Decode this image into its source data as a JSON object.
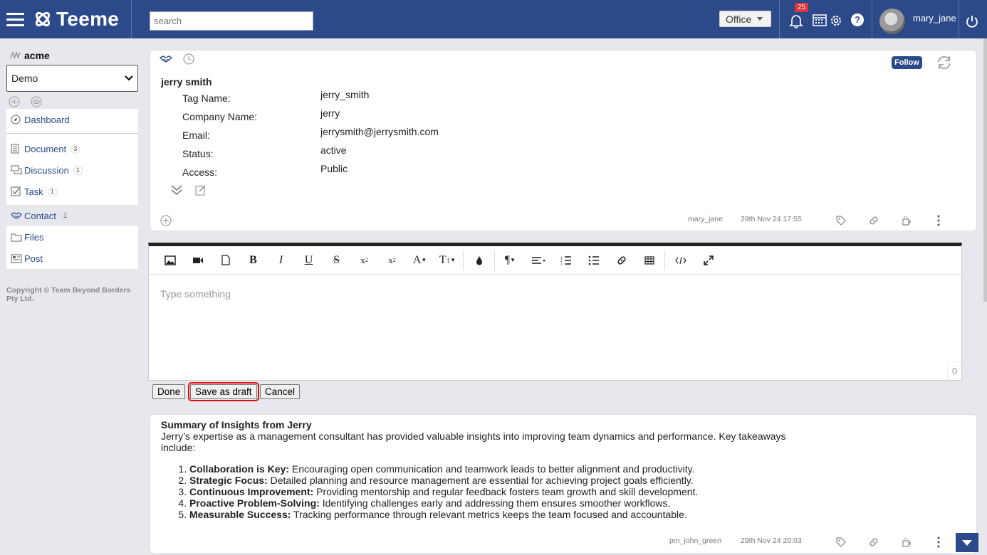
{
  "header": {
    "brand": "Teeme",
    "search_placeholder": "search",
    "office_label": "Office",
    "notification_count": "25",
    "help_label": "?",
    "username": "mary_jane"
  },
  "sidebar": {
    "org_name": "acme",
    "workspace": "Demo",
    "items": [
      {
        "label": "Dashboard",
        "count": ""
      },
      {
        "label": "Document",
        "count": "3"
      },
      {
        "label": "Discussion",
        "count": "1"
      },
      {
        "label": "Task",
        "count": "1"
      },
      {
        "label": "Contact",
        "count": "1"
      },
      {
        "label": "Files",
        "count": ""
      },
      {
        "label": "Post",
        "count": ""
      }
    ],
    "copyright": "Copyright © Team Beyond Borders Pty Ltd."
  },
  "contact": {
    "name": "jerry smith",
    "follow_label": "Follow",
    "fields": [
      {
        "label": "Tag Name:",
        "value": "jerry_smith"
      },
      {
        "label": "Company Name:",
        "value": "jerry"
      },
      {
        "label": "Email:",
        "value": "jerrysmith@jerrysmith.com"
      },
      {
        "label": "Status:",
        "value": "active"
      },
      {
        "label": "Access:",
        "value": "Public"
      }
    ],
    "author": "mary_jane",
    "timestamp": "29th Nov 24 17:55"
  },
  "editor": {
    "placeholder": "Type something",
    "char_count": "0",
    "buttons": {
      "done": "Done",
      "save_draft": "Save as draft",
      "cancel": "Cancel"
    }
  },
  "post": {
    "title": "Summary of Insights from Jerry",
    "intro": "Jerry’s expertise as a management consultant has provided valuable insights into improving team dynamics and performance. Key takeaways include:",
    "points": [
      {
        "bold": "Collaboration is Key:",
        "text": " Encouraging open communication and teamwork leads to better alignment and productivity."
      },
      {
        "bold": "Strategic Focus:",
        "text": " Detailed planning and resource management are essential for achieving project goals efficiently."
      },
      {
        "bold": "Continuous Improvement:",
        "text": " Providing mentorship and regular feedback fosters team growth and skill development."
      },
      {
        "bold": "Proactive Problem-Solving:",
        "text": " Identifying challenges early and addressing them ensures smoother workflows."
      },
      {
        "bold": "Measurable Success:",
        "text": " Tracking performance through relevant metrics keeps the team focused and accountable."
      }
    ],
    "author": "pm_john_green",
    "timestamp": "29th Nov 24 20:03"
  },
  "colors": {
    "brand": "#2c4a8a",
    "badge": "#e3343a",
    "highlight": "#e01010"
  }
}
